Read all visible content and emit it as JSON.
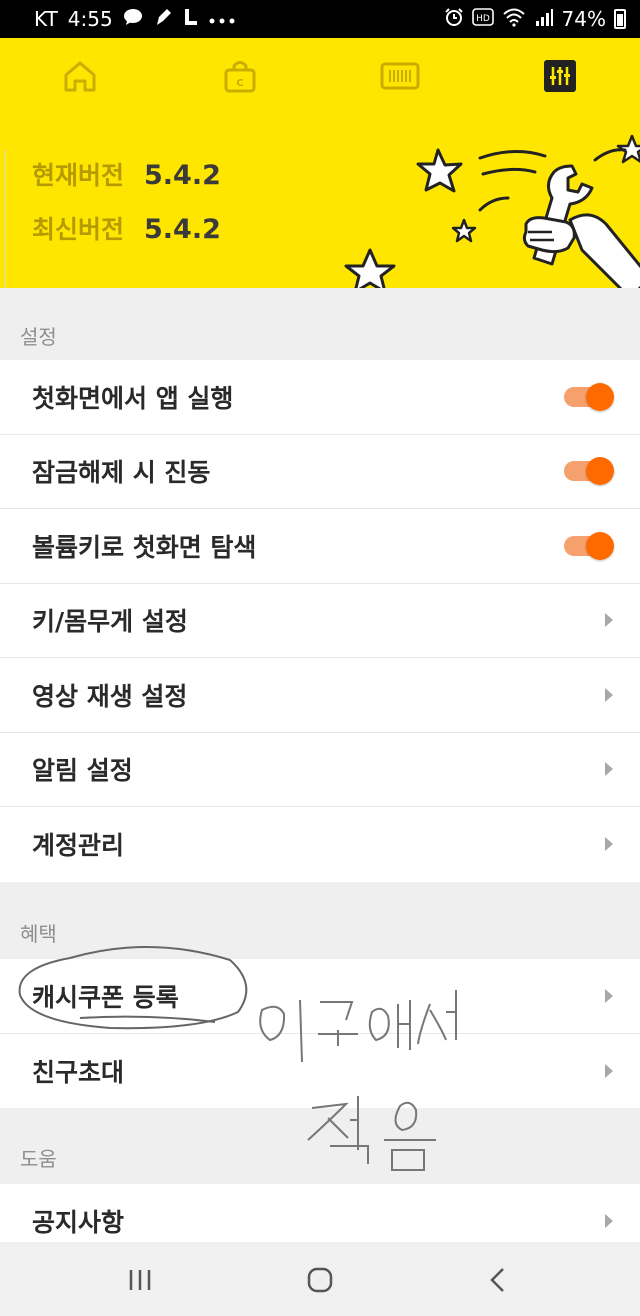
{
  "status_bar": {
    "carrier": "KT",
    "time": "4:55",
    "battery": "74%",
    "icons": [
      "chat-bubble-icon",
      "pen-icon",
      "l-icon",
      "more-dots-icon",
      "alarm-icon",
      "hd-icon",
      "wifi-icon",
      "signal-icon",
      "battery-icon"
    ]
  },
  "header": {
    "tabs": [
      "home-icon",
      "shopping-bag-icon",
      "barcode-icon",
      "settings-sliders-icon"
    ],
    "active_tab": "settings-sliders-icon",
    "current_version_label": "현재버전",
    "current_version": "5.4.2",
    "latest_version_label": "최신버전",
    "latest_version": "5.4.2"
  },
  "sections": {
    "settings": {
      "title": "설정",
      "items": [
        {
          "label": "첫화면에서 앱 실행",
          "control": "toggle",
          "on": true
        },
        {
          "label": "잠금해제 시 진동",
          "control": "toggle",
          "on": true
        },
        {
          "label": "볼륨키로 첫화면 탐색",
          "control": "toggle",
          "on": true
        },
        {
          "label": "키/몸무게 설정",
          "control": "chevron"
        },
        {
          "label": "영상 재생 설정",
          "control": "chevron"
        },
        {
          "label": "알림 설정",
          "control": "chevron"
        },
        {
          "label": "계정관리",
          "control": "chevron"
        }
      ]
    },
    "benefits": {
      "title": "혜택",
      "items": [
        {
          "label": "캐시쿠폰 등록",
          "control": "chevron"
        },
        {
          "label": "친구초대",
          "control": "chevron"
        }
      ]
    },
    "help": {
      "title": "도움",
      "items": [
        {
          "label": "공지사항",
          "control": "chevron"
        }
      ]
    }
  },
  "annotation": {
    "handwritten_text": "이곳에서 적음"
  },
  "colors": {
    "header_yellow": "#ffe600",
    "toggle_orange": "#ff6a00",
    "version_label": "#b59b00"
  }
}
